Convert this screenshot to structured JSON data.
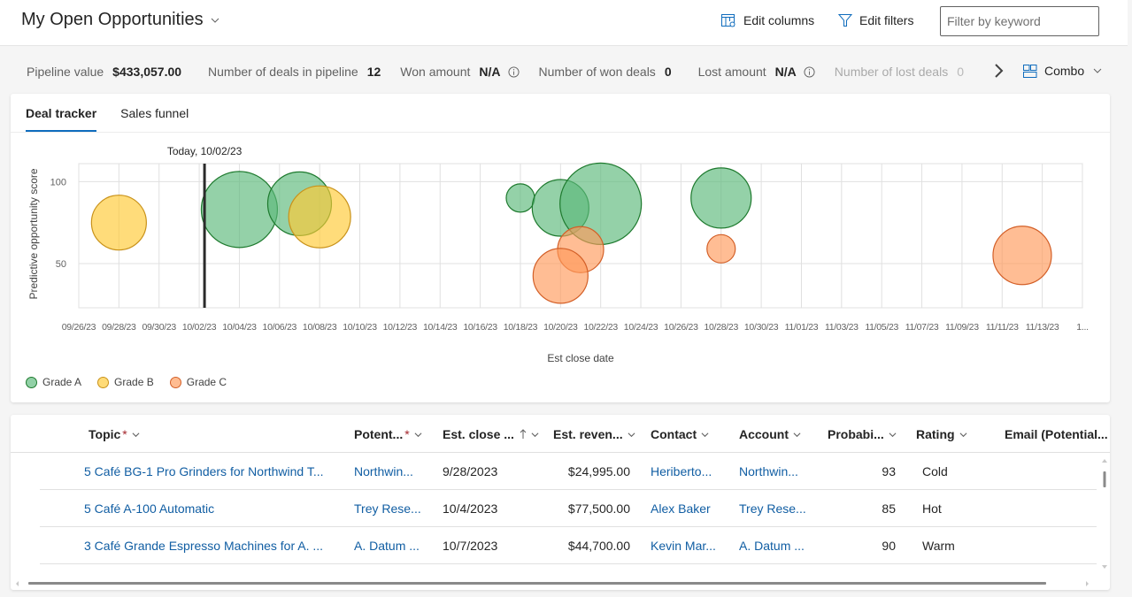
{
  "header": {
    "title": "My Open Opportunities",
    "edit_columns_label": "Edit columns",
    "edit_filters_label": "Edit filters",
    "search_placeholder": "Filter by keyword",
    "search_value": ""
  },
  "kpis": [
    {
      "label": "Pipeline value",
      "value": "$433,057.00",
      "info": false
    },
    {
      "label": "Number of deals in pipeline",
      "value": "12",
      "info": false
    },
    {
      "label": "Won amount",
      "value": "N/A",
      "info": true
    },
    {
      "label": "Number of won deals",
      "value": "0",
      "info": false
    },
    {
      "label": "Lost amount",
      "value": "N/A",
      "info": true
    },
    {
      "label": "Number of lost deals",
      "value": "0",
      "info": false
    }
  ],
  "view_selector": {
    "label": "Combo"
  },
  "chart_tabs": [
    {
      "label": "Deal tracker",
      "active": true
    },
    {
      "label": "Sales funnel",
      "active": false
    }
  ],
  "colors": {
    "grade_a_fill": "#5ab97a",
    "grade_a_stroke": "#1e7a2e",
    "grade_b_fill": "#ffc933",
    "grade_b_stroke": "#c9921a",
    "grade_c_fill": "#ff9a5a",
    "grade_c_stroke": "#d35f27",
    "today_line": "#2b2b2b",
    "tab_accent": "#0f6cbd",
    "link": "#115ea3"
  },
  "chart_data": {
    "type": "scatter",
    "subtype": "bubble",
    "title": "",
    "xlabel": "Est close date",
    "ylabel": "Predictive opportunity score",
    "x_ticks": [
      "09/26/23",
      "09/28/23",
      "09/30/23",
      "10/02/23",
      "10/04/23",
      "10/06/23",
      "10/08/23",
      "10/10/23",
      "10/12/23",
      "10/14/23",
      "10/16/23",
      "10/18/23",
      "10/20/23",
      "10/22/23",
      "10/24/23",
      "10/26/23",
      "10/28/23",
      "10/30/23",
      "11/01/23",
      "11/03/23",
      "11/05/23",
      "11/07/23",
      "11/09/23",
      "11/11/23",
      "11/13/23",
      "1..."
    ],
    "x_range": [
      "2023-09-26",
      "2023-11-15"
    ],
    "y_ticks": [
      50,
      100
    ],
    "y_range": [
      23,
      111
    ],
    "grid": true,
    "today_marker": {
      "label": "Today, 10/02/23",
      "date": "2023-10-02"
    },
    "legend": {
      "position": "bottom-left",
      "entries": [
        "Grade A",
        "Grade B",
        "Grade C"
      ]
    },
    "series": [
      {
        "name": "Grade A",
        "points": [
          {
            "date": "2023-10-04",
            "score": 83,
            "size": 43
          },
          {
            "date": "2023-10-07",
            "score": 86.5,
            "size": 36
          },
          {
            "date": "2023-10-18",
            "score": 90,
            "size": 16
          },
          {
            "date": "2023-10-20",
            "score": 84,
            "size": 32
          },
          {
            "date": "2023-10-22",
            "score": 86.5,
            "size": 46
          },
          {
            "date": "2023-10-28",
            "score": 90,
            "size": 34
          }
        ]
      },
      {
        "name": "Grade B",
        "points": [
          {
            "date": "2023-09-28",
            "score": 75,
            "size": 31
          },
          {
            "date": "2023-10-08",
            "score": 78.5,
            "size": 35
          }
        ]
      },
      {
        "name": "Grade C",
        "points": [
          {
            "date": "2023-10-21",
            "score": 58.5,
            "size": 26
          },
          {
            "date": "2023-10-20",
            "score": 42.5,
            "size": 31
          },
          {
            "date": "2023-10-28",
            "score": 59,
            "size": 16
          },
          {
            "date": "2023-11-12",
            "score": 55,
            "size": 33
          }
        ]
      }
    ]
  },
  "grid": {
    "columns": [
      {
        "label": "Topic",
        "required": true,
        "sorted": false
      },
      {
        "label": "Potent...",
        "required": true,
        "sorted": false
      },
      {
        "label": "Est. close ...",
        "required": false,
        "sorted": true
      },
      {
        "label": "Est. reven...",
        "required": false,
        "sorted": false
      },
      {
        "label": "Contact",
        "required": false,
        "sorted": false
      },
      {
        "label": "Account",
        "required": false,
        "sorted": false
      },
      {
        "label": "Probabi...",
        "required": false,
        "sorted": false
      },
      {
        "label": "Rating",
        "required": false,
        "sorted": false
      },
      {
        "label": "Email (Potential...",
        "required": false,
        "sorted": false
      }
    ],
    "rows": [
      {
        "topic": "5 Café BG-1 Pro Grinders for Northwind T...",
        "potential": "Northwin...",
        "close": "9/28/2023",
        "revenue": "$24,995.00",
        "contact": "Heriberto...",
        "account": "Northwin...",
        "probability": "93",
        "rating": "Cold",
        "email": ""
      },
      {
        "topic": "5 Café A-100 Automatic",
        "potential": "Trey Rese...",
        "close": "10/4/2023",
        "revenue": "$77,500.00",
        "contact": "Alex Baker",
        "account": "Trey Rese...",
        "probability": "85",
        "rating": "Hot",
        "email": ""
      },
      {
        "topic": "3 Café Grande Espresso Machines for A. ...",
        "potential": "A. Datum ...",
        "close": "10/7/2023",
        "revenue": "$44,700.00",
        "contact": "Kevin Mar...",
        "account": "A. Datum ...",
        "probability": "90",
        "rating": "Warm",
        "email": ""
      }
    ]
  }
}
